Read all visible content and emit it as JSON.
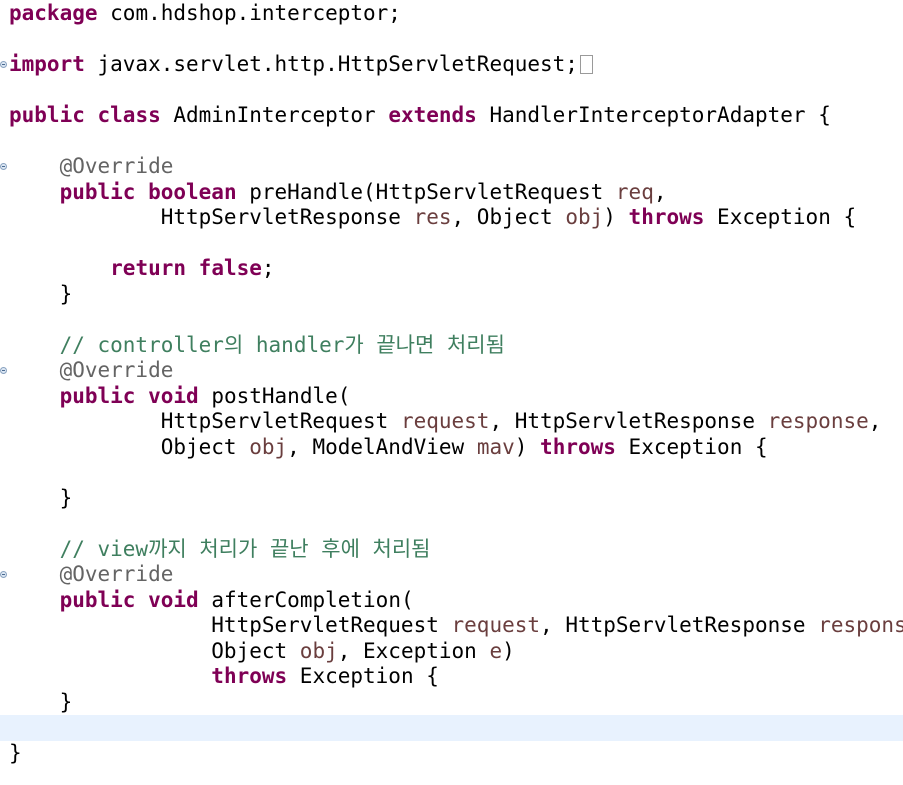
{
  "editor": {
    "language": "java",
    "current_line_index": 28,
    "lines": [
      {
        "tokens": [
          {
            "t": "package",
            "c": "kw"
          },
          {
            "t": " com.hdshop.interceptor;",
            "c": ""
          }
        ]
      },
      {
        "tokens": []
      },
      {
        "fold": true,
        "folded_marker": true,
        "tokens": [
          {
            "t": "import",
            "c": "kw"
          },
          {
            "t": " javax.servlet.http.HttpServletRequest;",
            "c": ""
          }
        ]
      },
      {
        "tokens": []
      },
      {
        "tokens": [
          {
            "t": "public",
            "c": "kw"
          },
          {
            "t": " ",
            "c": ""
          },
          {
            "t": "class",
            "c": "kw"
          },
          {
            "t": " AdminInterceptor ",
            "c": ""
          },
          {
            "t": "extends",
            "c": "kw"
          },
          {
            "t": " HandlerInterceptorAdapter {",
            "c": ""
          }
        ]
      },
      {
        "tokens": []
      },
      {
        "fold": true,
        "tokens": [
          {
            "t": "    ",
            "c": ""
          },
          {
            "t": "@Override",
            "c": "ann"
          }
        ]
      },
      {
        "tokens": [
          {
            "t": "    ",
            "c": ""
          },
          {
            "t": "public",
            "c": "kw"
          },
          {
            "t": " ",
            "c": ""
          },
          {
            "t": "boolean",
            "c": "kw"
          },
          {
            "t": " preHandle(HttpServletRequest ",
            "c": ""
          },
          {
            "t": "req",
            "c": "var"
          },
          {
            "t": ",",
            "c": ""
          }
        ]
      },
      {
        "tokens": [
          {
            "t": "            HttpServletResponse ",
            "c": ""
          },
          {
            "t": "res",
            "c": "var"
          },
          {
            "t": ", Object ",
            "c": ""
          },
          {
            "t": "obj",
            "c": "var"
          },
          {
            "t": ") ",
            "c": ""
          },
          {
            "t": "throws",
            "c": "kw"
          },
          {
            "t": " Exception {",
            "c": ""
          }
        ]
      },
      {
        "tokens": []
      },
      {
        "tokens": [
          {
            "t": "        ",
            "c": ""
          },
          {
            "t": "return",
            "c": "kw"
          },
          {
            "t": " ",
            "c": ""
          },
          {
            "t": "false",
            "c": "kw"
          },
          {
            "t": ";",
            "c": ""
          }
        ]
      },
      {
        "tokens": [
          {
            "t": "    }",
            "c": ""
          }
        ]
      },
      {
        "tokens": []
      },
      {
        "tokens": [
          {
            "t": "    ",
            "c": ""
          },
          {
            "t": "// controller의 handler가 끝나면 처리됨",
            "c": "cmt"
          }
        ]
      },
      {
        "fold": true,
        "tokens": [
          {
            "t": "    ",
            "c": ""
          },
          {
            "t": "@Override",
            "c": "ann"
          }
        ]
      },
      {
        "tokens": [
          {
            "t": "    ",
            "c": ""
          },
          {
            "t": "public",
            "c": "kw"
          },
          {
            "t": " ",
            "c": ""
          },
          {
            "t": "void",
            "c": "kw"
          },
          {
            "t": " postHandle(",
            "c": ""
          }
        ]
      },
      {
        "tokens": [
          {
            "t": "            HttpServletRequest ",
            "c": ""
          },
          {
            "t": "request",
            "c": "var"
          },
          {
            "t": ", HttpServletResponse ",
            "c": ""
          },
          {
            "t": "response",
            "c": "var"
          },
          {
            "t": ",",
            "c": ""
          }
        ]
      },
      {
        "tokens": [
          {
            "t": "            Object ",
            "c": ""
          },
          {
            "t": "obj",
            "c": "var"
          },
          {
            "t": ", ModelAndView ",
            "c": ""
          },
          {
            "t": "mav",
            "c": "var"
          },
          {
            "t": ") ",
            "c": ""
          },
          {
            "t": "throws",
            "c": "kw"
          },
          {
            "t": " Exception {",
            "c": ""
          }
        ]
      },
      {
        "tokens": []
      },
      {
        "tokens": [
          {
            "t": "    }",
            "c": ""
          }
        ]
      },
      {
        "tokens": []
      },
      {
        "tokens": [
          {
            "t": "    ",
            "c": ""
          },
          {
            "t": "// view까지 처리가 끝난 후에 처리됨",
            "c": "cmt"
          }
        ]
      },
      {
        "fold": true,
        "tokens": [
          {
            "t": "    ",
            "c": ""
          },
          {
            "t": "@Override",
            "c": "ann"
          }
        ]
      },
      {
        "tokens": [
          {
            "t": "    ",
            "c": ""
          },
          {
            "t": "public",
            "c": "kw"
          },
          {
            "t": " ",
            "c": ""
          },
          {
            "t": "void",
            "c": "kw"
          },
          {
            "t": " afterCompletion(",
            "c": ""
          }
        ]
      },
      {
        "tokens": [
          {
            "t": "                HttpServletRequest ",
            "c": ""
          },
          {
            "t": "request",
            "c": "var"
          },
          {
            "t": ", HttpServletResponse ",
            "c": ""
          },
          {
            "t": "response",
            "c": "var"
          },
          {
            "t": ",",
            "c": ""
          }
        ]
      },
      {
        "tokens": [
          {
            "t": "                Object ",
            "c": ""
          },
          {
            "t": "obj",
            "c": "var"
          },
          {
            "t": ", Exception ",
            "c": ""
          },
          {
            "t": "e",
            "c": "var"
          },
          {
            "t": ")",
            "c": ""
          }
        ]
      },
      {
        "tokens": [
          {
            "t": "                ",
            "c": ""
          },
          {
            "t": "throws",
            "c": "kw"
          },
          {
            "t": " Exception {",
            "c": ""
          }
        ]
      },
      {
        "tokens": [
          {
            "t": "    }",
            "c": ""
          }
        ]
      },
      {
        "tokens": []
      },
      {
        "tokens": [
          {
            "t": "}",
            "c": ""
          }
        ]
      }
    ]
  },
  "colors": {
    "keyword": "#7f0055",
    "annotation": "#646464",
    "variable": "#6a3e3e",
    "comment": "#3f7f5f",
    "current_line": "#e8f2fe"
  }
}
